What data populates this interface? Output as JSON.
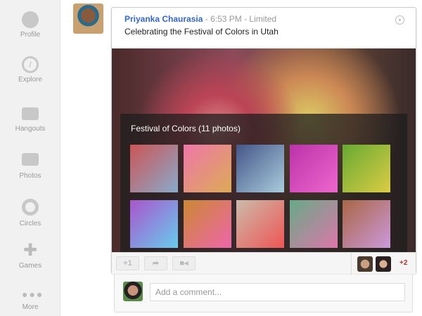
{
  "sidebar": {
    "items": [
      {
        "label": "Profile"
      },
      {
        "label": "Explore"
      },
      {
        "label": "Hangouts"
      },
      {
        "label": "Photos"
      },
      {
        "label": "Circles"
      },
      {
        "label": "Games"
      },
      {
        "label": "More"
      }
    ]
  },
  "post": {
    "author": "Priyanka Chaurasia",
    "meta": " - 6:53 PM - Limited",
    "caption": "Celebrating the Festival of Colors in Utah",
    "album_title": "Festival of Colors (11 photos)",
    "actions": {
      "plus_one": "+1"
    },
    "sharers_extra": "+2"
  },
  "comment": {
    "placeholder": "Add a comment..."
  },
  "colors": {
    "link": "#3366cc",
    "accent_red": "#aa3333"
  }
}
